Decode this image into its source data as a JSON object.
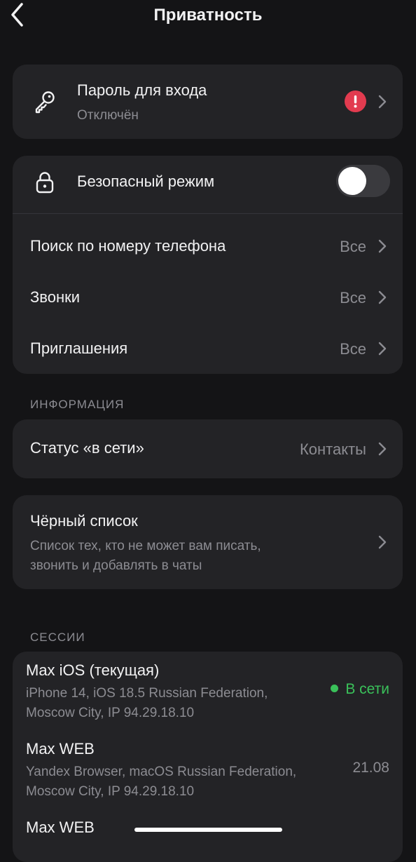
{
  "header": {
    "title": "Приватность",
    "back_icon": "chevron-left-icon"
  },
  "password_card": {
    "icon": "key-icon",
    "label": "Пароль для входа",
    "status": "Отключён",
    "alert_icon": "exclamation-icon",
    "alert_color": "#e23b4f"
  },
  "privacy_card": {
    "safe_mode": {
      "icon": "lock-icon",
      "label": "Безопасный режим",
      "enabled": false
    },
    "items": [
      {
        "label": "Поиск по номеру телефона",
        "value": "Все"
      },
      {
        "label": "Звонки",
        "value": "Все"
      },
      {
        "label": "Приглашения",
        "value": "Все"
      }
    ]
  },
  "info_section": {
    "header": "ИНФОРМАЦИЯ",
    "online_status": {
      "label": "Статус «в сети»",
      "value": "Контакты"
    }
  },
  "blacklist": {
    "label": "Чёрный список",
    "description_line1": "Список тех, кто не может вам писать,",
    "description_line2": "звонить и добавлять в чаты"
  },
  "sessions": {
    "header": "СЕССИИ",
    "online_color": "#3ac15a",
    "items": [
      {
        "name": "Max iOS (текущая)",
        "details_line1": "iPhone 14, iOS 18.5 Russian Federation,",
        "details_line2": "Moscow City, IP 94.29.18.10",
        "status": "В сети"
      },
      {
        "name": "Max WEB",
        "details_line1": "Yandex Browser, macOS Russian Federation,",
        "details_line2": "Moscow City, IP 94.29.18.10",
        "time": "21.08"
      },
      {
        "name": "Max WEB"
      }
    ]
  }
}
